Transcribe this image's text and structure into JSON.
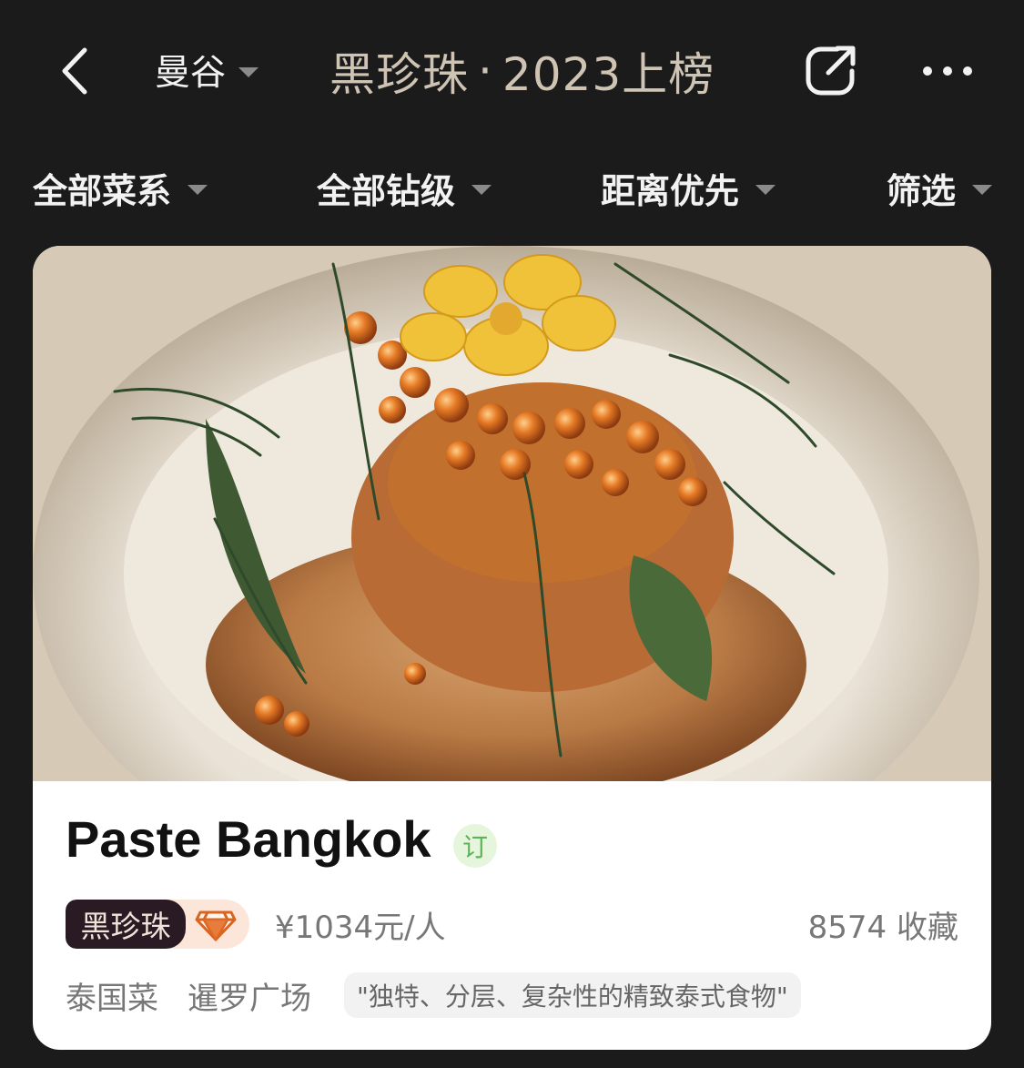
{
  "header": {
    "city": "曼谷",
    "title_brand": "黑珍珠",
    "title_separator": "·",
    "title_year": "2023上榜"
  },
  "filters": [
    {
      "label": "全部菜系"
    },
    {
      "label": "全部钻级"
    },
    {
      "label": "距离优先"
    },
    {
      "label": "筛选"
    }
  ],
  "restaurant": {
    "name": "Paste Bangkok",
    "book_badge": "订",
    "pearl_label": "黑珍珠",
    "price": "¥1034元/人",
    "favorites": "8574 收藏",
    "cuisine": "泰国菜",
    "area": "暹罗广场",
    "quote": "\"独特、分层、复杂性的精致泰式食物\""
  },
  "icons": {
    "back": "chevron-left-icon",
    "share": "share-icon",
    "more": "more-icon",
    "diamond": "diamond-icon"
  },
  "colors": {
    "background": "#1b1b1b",
    "title_gold": "#cfc3b4",
    "booking_green": "#5db35a",
    "pearl_dark": "#2a1a24",
    "diamond_orange": "#e0662a"
  }
}
